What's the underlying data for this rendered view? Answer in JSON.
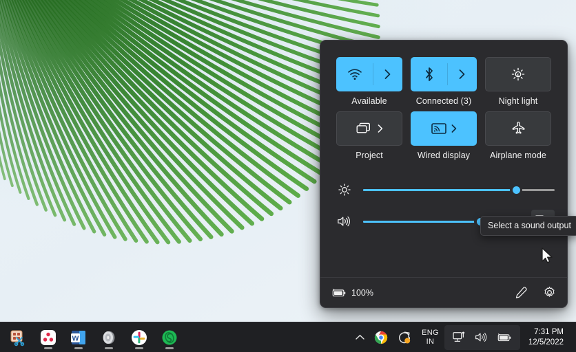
{
  "desktop": {
    "wallpaper_name": "palm-frond-wallpaper",
    "sky_color": "#e9f1f6",
    "frond_color": "#2f7a27"
  },
  "quick_settings": {
    "panel_name": "Quick Settings",
    "accent_color": "#4cc2ff",
    "panel_background": "#2b2b2e",
    "tiles": [
      {
        "id": "wifi",
        "icon": "wifi-icon",
        "label": "Available",
        "active": true,
        "has_chevron": true,
        "chevron_style": "split"
      },
      {
        "id": "bluetooth",
        "icon": "bluetooth-icon",
        "label": "Connected (3)",
        "active": true,
        "has_chevron": true,
        "chevron_style": "split"
      },
      {
        "id": "night-light",
        "icon": "night-light-icon",
        "label": "Night light",
        "active": false,
        "has_chevron": false,
        "chevron_style": "none"
      },
      {
        "id": "project",
        "icon": "project-icon",
        "label": "Project",
        "active": false,
        "has_chevron": true,
        "chevron_style": "inline"
      },
      {
        "id": "wired-display",
        "icon": "cast-display-icon",
        "label": "Wired display",
        "active": true,
        "has_chevron": true,
        "chevron_style": "inline"
      },
      {
        "id": "airplane",
        "icon": "airplane-icon",
        "label": "Airplane mode",
        "active": false,
        "has_chevron": false,
        "chevron_style": "none"
      }
    ],
    "sliders": [
      {
        "id": "brightness",
        "icon": "brightness-icon",
        "value": 80,
        "min": 0,
        "max": 100,
        "trailing_button": null
      },
      {
        "id": "volume",
        "icon": "volume-icon",
        "value": 74,
        "min": 0,
        "max": 100,
        "trailing_button": "sound-output-selector"
      }
    ],
    "tooltip": {
      "text": "Select a sound output",
      "target": "sound-output-selector"
    },
    "footer": {
      "battery_icon": "battery-charging-icon",
      "battery_percent": "100%",
      "edit_icon": "pencil-edit-icon",
      "settings_icon": "gear-settings-icon"
    }
  },
  "taskbar": {
    "background": "#1f2023",
    "apps": [
      {
        "id": "snipping-tool",
        "name": "Snipping Tool",
        "running": false
      },
      {
        "id": "app-red-dots",
        "name": "Red Dots App",
        "running": true
      },
      {
        "id": "word",
        "name": "Microsoft Word",
        "running": true
      },
      {
        "id": "app-gray-disc",
        "name": "Gray Disc App",
        "running": true
      },
      {
        "id": "slack",
        "name": "Slack",
        "running": true
      },
      {
        "id": "app-green",
        "name": "Green App",
        "running": true
      }
    ],
    "tray": {
      "overflow_icon": "chevron-up-icon",
      "chrome_icon": "chrome-icon",
      "update_icon": "update-notification-icon",
      "language_line1": "ENG",
      "language_line2": "IN",
      "cluster": [
        {
          "id": "network",
          "icon": "network-monitor-icon"
        },
        {
          "id": "volume",
          "icon": "volume-icon"
        },
        {
          "id": "battery",
          "icon": "battery-charging-icon"
        }
      ],
      "time": "7:31 PM",
      "date": "12/5/2022"
    }
  }
}
